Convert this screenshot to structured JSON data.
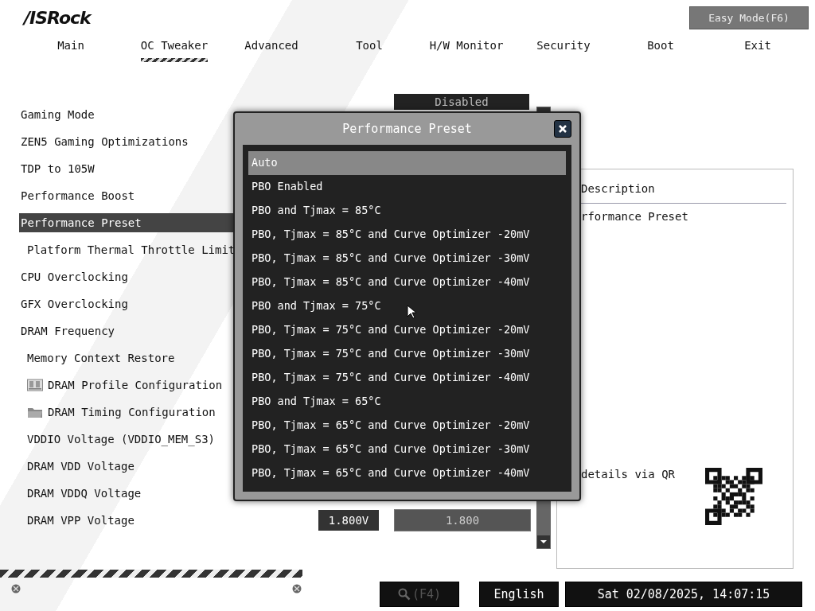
{
  "brand": {
    "logo": "/ISRock"
  },
  "easy_mode_button": "Easy Mode(F6)",
  "tabs": [
    {
      "label": "Main",
      "selected": false
    },
    {
      "label": "OC Tweaker",
      "selected": true
    },
    {
      "label": "Advanced",
      "selected": false
    },
    {
      "label": "Tool",
      "selected": false
    },
    {
      "label": "H/W Monitor",
      "selected": false
    },
    {
      "label": "Security",
      "selected": false
    },
    {
      "label": "Boot",
      "selected": false
    },
    {
      "label": "Exit",
      "selected": false
    }
  ],
  "settings": [
    {
      "label": "Gaming Mode",
      "kind": "setting",
      "selected": false,
      "value": "Disabled"
    },
    {
      "label": "ZEN5 Gaming Optimizations",
      "kind": "setting",
      "selected": false
    },
    {
      "label": "TDP to 105W",
      "kind": "setting",
      "selected": false
    },
    {
      "label": "Performance Boost",
      "kind": "setting",
      "selected": false
    },
    {
      "label": "Performance Preset",
      "kind": "setting",
      "selected": true,
      "children": [
        {
          "label": "Platform Thermal Throttle Limit",
          "kind": "setting",
          "selected": false
        }
      ]
    },
    {
      "label": "CPU Overclocking",
      "kind": "setting",
      "selected": false
    },
    {
      "label": "GFX Overclocking",
      "kind": "setting",
      "selected": false
    },
    {
      "label": "DRAM Frequency",
      "kind": "setting",
      "selected": false,
      "children": [
        {
          "label": "Memory Context Restore",
          "kind": "setting",
          "selected": false
        },
        {
          "label": "DRAM Profile Configuration",
          "kind": "memory-menu",
          "selected": false
        },
        {
          "label": "DRAM Timing Configuration",
          "kind": "folder-menu",
          "selected": false
        },
        {
          "label": "VDDIO Voltage (VDDIO_MEM_S3)",
          "kind": "setting",
          "selected": false
        },
        {
          "label": "DRAM VDD Voltage",
          "kind": "setting",
          "selected": false
        },
        {
          "label": "DRAM VDDQ Voltage",
          "kind": "setting",
          "selected": false
        },
        {
          "label": "DRAM VPP Voltage",
          "kind": "setting",
          "selected": false,
          "reading": "1.800V",
          "input": "1.800"
        }
      ]
    }
  ],
  "description": {
    "title": "Description",
    "text": "rformance Preset",
    "qr_hint": "details via QR"
  },
  "popup": {
    "title": "Performance Preset",
    "options": [
      {
        "label": "Auto",
        "selected": true
      },
      {
        "label": "PBO Enabled",
        "selected": false
      },
      {
        "label": "PBO and Tjmax = 85°C",
        "selected": false
      },
      {
        "label": "PBO, Tjmax = 85°C and Curve Optimizer -20mV",
        "selected": false
      },
      {
        "label": "PBO, Tjmax = 85°C and Curve Optimizer -30mV",
        "selected": false
      },
      {
        "label": "PBO, Tjmax = 85°C and Curve Optimizer -40mV",
        "selected": false
      },
      {
        "label": "PBO and Tjmax = 75°C",
        "selected": false
      },
      {
        "label": "PBO, Tjmax = 75°C and Curve Optimizer -20mV",
        "selected": false
      },
      {
        "label": "PBO, Tjmax = 75°C and Curve Optimizer -30mV",
        "selected": false
      },
      {
        "label": "PBO, Tjmax = 75°C and Curve Optimizer -40mV",
        "selected": false
      },
      {
        "label": "PBO and Tjmax = 65°C",
        "selected": false
      },
      {
        "label": "PBO, Tjmax = 65°C and Curve Optimizer -20mV",
        "selected": false
      },
      {
        "label": "PBO, Tjmax = 65°C and Curve Optimizer -30mV",
        "selected": false
      },
      {
        "label": "PBO, Tjmax = 65°C and Curve Optimizer -40mV",
        "selected": false
      }
    ]
  },
  "footer": {
    "search": "(F4)",
    "language": "English",
    "datetime": "Sat 02/08/2025, 14:07:15"
  }
}
